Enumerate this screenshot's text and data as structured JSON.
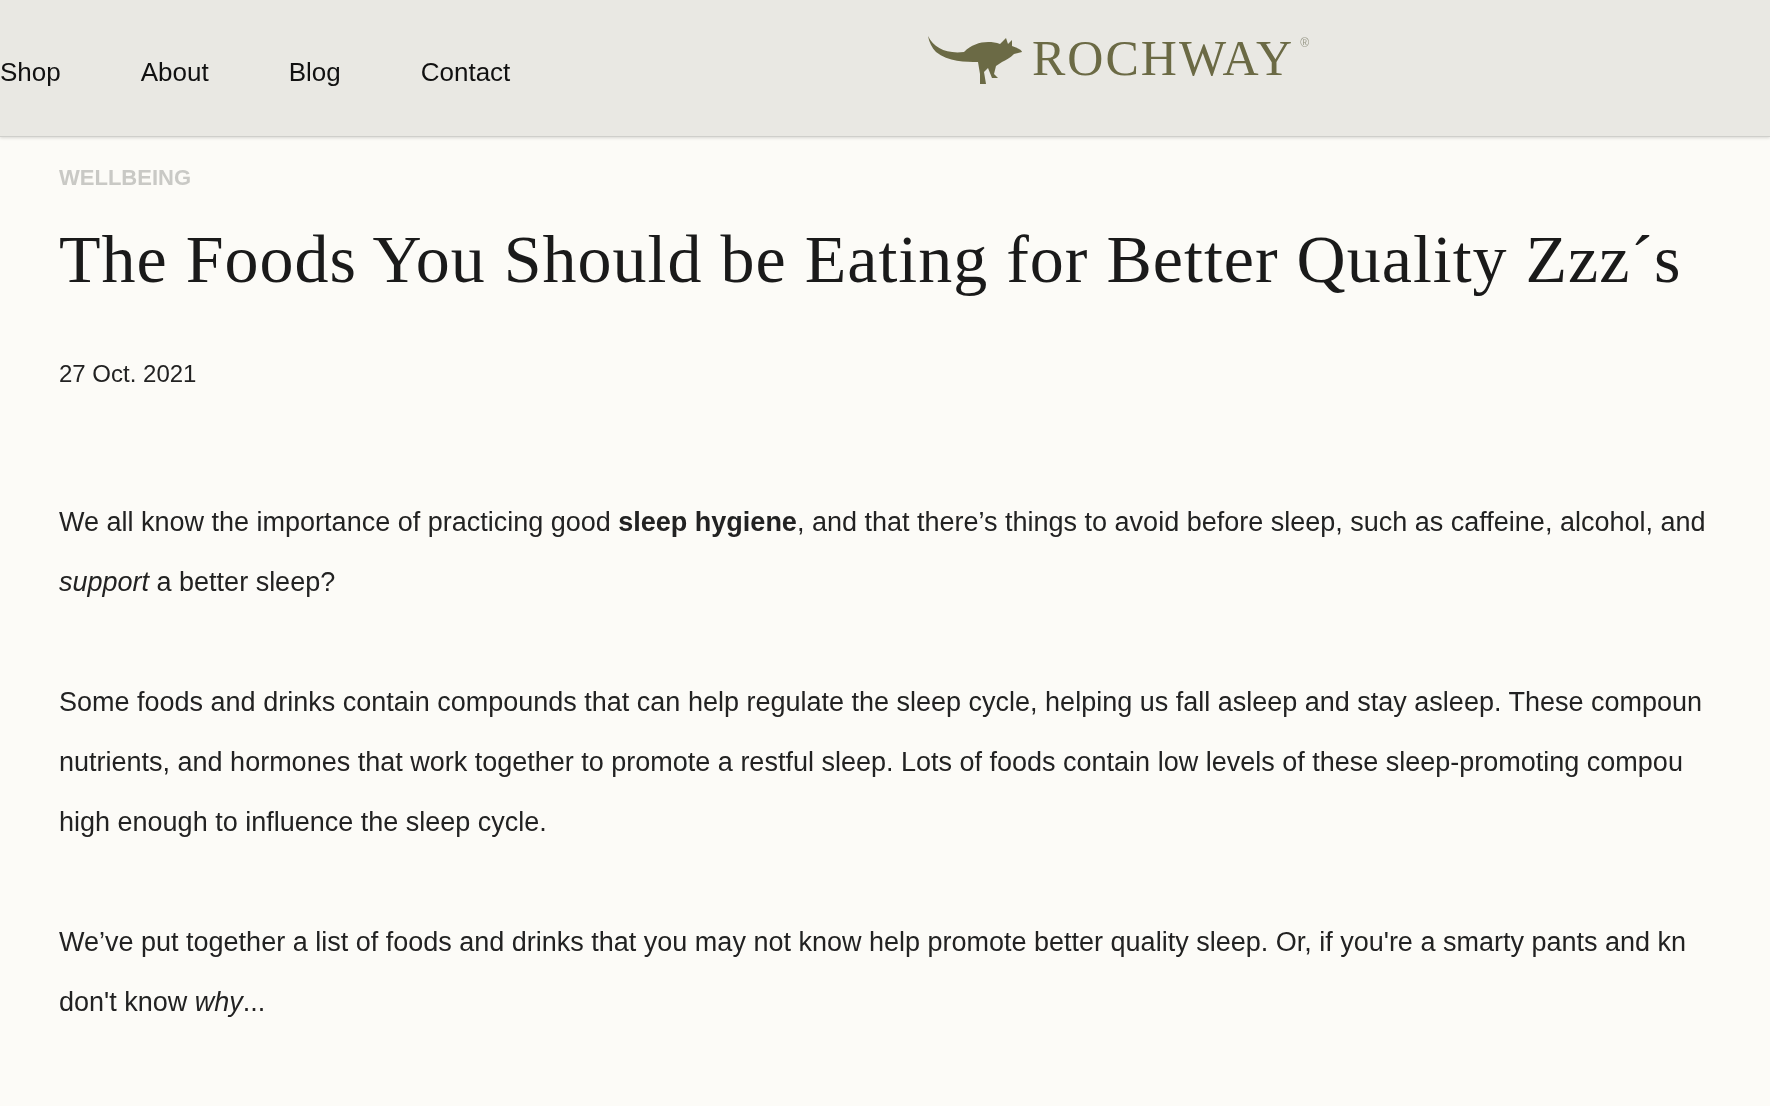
{
  "header": {
    "nav": [
      {
        "label": "Shop"
      },
      {
        "label": "About"
      },
      {
        "label": "Blog"
      },
      {
        "label": "Contact"
      }
    ],
    "logo": "ROCHWAY",
    "logo_mark": "®"
  },
  "article": {
    "category": "WELLBEING",
    "title": "The Foods You Should be Eating for Better Quality Zzz´s",
    "date": "27 Oct. 2021",
    "paragraphs": [
      {
        "lines": [
          "We all know the importance of practicing good **sleep hygiene**, and that there’s things to avoid before sleep, such as caffeine, alcohol, and",
          "*support* a better sleep?"
        ]
      },
      {
        "lines": [
          "Some foods and drinks contain compounds that can help regulate the sleep cycle, helping us fall asleep and stay asleep. These compoun",
          "nutrients, and hormones that work together to promote a restful sleep. Lots of foods contain low levels of these sleep-promoting compou",
          "high enough to influence the sleep cycle."
        ]
      },
      {
        "lines": [
          "We’ve put together a list of foods and drinks that you may not know help promote better quality sleep. Or, if you're a smarty pants and kn",
          "don't know *why*..."
        ]
      }
    ]
  }
}
